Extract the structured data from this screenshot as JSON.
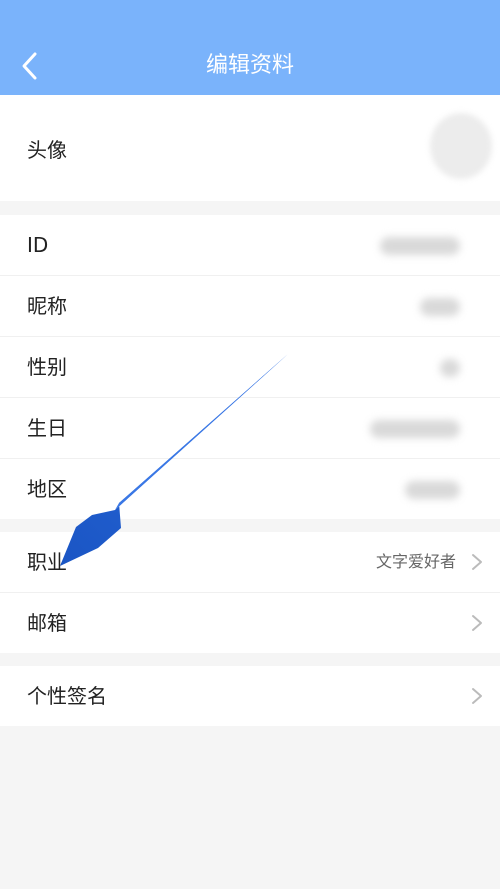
{
  "header": {
    "title": "编辑资料",
    "back_icon": "chevron-left-icon",
    "background": "#7ab3fb"
  },
  "profile": {
    "avatar_label": "头像"
  },
  "basic_info": [
    {
      "label": "ID"
    },
    {
      "label": "昵称"
    },
    {
      "label": "性别"
    },
    {
      "label": "生日"
    },
    {
      "label": "地区"
    }
  ],
  "occupation": {
    "label": "职业",
    "value": "文字爱好者"
  },
  "email": {
    "label": "邮箱"
  },
  "signature": {
    "label": "个性签名"
  },
  "annotation": {
    "color": "#1f5cc8",
    "icon": "pointer-arrow-icon"
  }
}
